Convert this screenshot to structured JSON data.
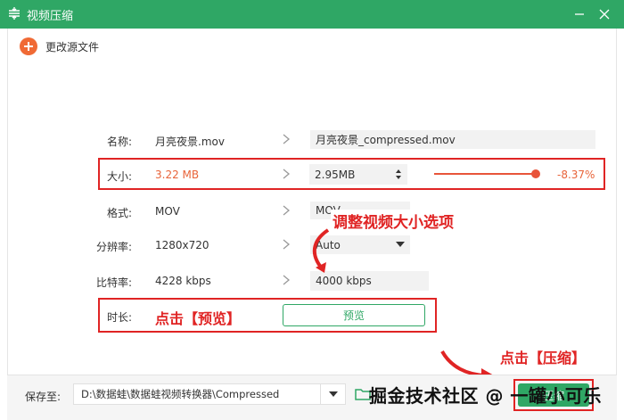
{
  "titlebar": {
    "title": "视频压缩"
  },
  "toolbar": {
    "change_source_label": "更改源文件"
  },
  "rows": {
    "name": {
      "label": "名称:",
      "source": "月亮夜景.mov",
      "target": "月亮夜景_compressed.mov"
    },
    "size": {
      "label": "大小:",
      "source": "3.22 MB",
      "target": "2.95MB",
      "percent": "-8.37%",
      "slider_fraction": 0.92
    },
    "format": {
      "label": "格式:",
      "source": "MOV",
      "target": "MOV"
    },
    "resolution": {
      "label": "分辨率:",
      "source": "1280x720",
      "target": "Auto"
    },
    "bitrate": {
      "label": "比特率:",
      "source": "4228 kbps",
      "target": "4000 kbps"
    },
    "duration": {
      "label": "时长:",
      "preview_label": "预览"
    }
  },
  "annotations": {
    "adjust": "调整视频大小选项",
    "click_preview": "点击【预览】",
    "click_compress": "点击【压缩】"
  },
  "footer": {
    "save_label": "保存至:",
    "save_path": "D:\\数据蛙\\数据蛙视频转换器\\Compressed",
    "compress_label": "压缩"
  },
  "watermark": "掘金技术社区 @ 一罐小可乐",
  "colors": {
    "brand_green": "#2fa765",
    "accent_orange": "#f06a35",
    "annotation_red": "#e02424"
  }
}
